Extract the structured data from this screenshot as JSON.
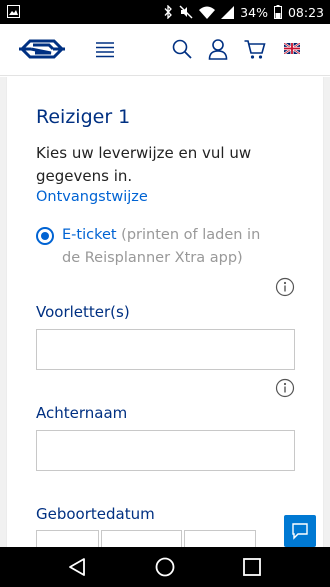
{
  "status_bar": {
    "battery": "34%",
    "time": "08:23"
  },
  "header": {
    "logo_icon": "ns-logo-icon",
    "menu_icon": "hamburger-menu-icon",
    "search_icon": "search-icon",
    "account_icon": "user-icon",
    "cart_icon": "cart-icon",
    "language_icon": "uk-flag-icon"
  },
  "form": {
    "title": "Reiziger 1",
    "instruction": "Kies uw leverwijze en vul uw gegevens in.",
    "delivery_label": "Ontvangstwijze",
    "delivery_option": {
      "title": "E-ticket",
      "description": " (printen of laden in de Reisplanner Xtra app)",
      "selected": true
    },
    "initials": {
      "label": "Voorletter(s)",
      "value": ""
    },
    "surname": {
      "label": "Achternaam",
      "value": ""
    },
    "birthdate": {
      "label": "Geboortedatum"
    }
  },
  "colors": {
    "brand_blue": "#003082",
    "link_blue": "#0063d3",
    "chat_blue": "#0079d3"
  }
}
